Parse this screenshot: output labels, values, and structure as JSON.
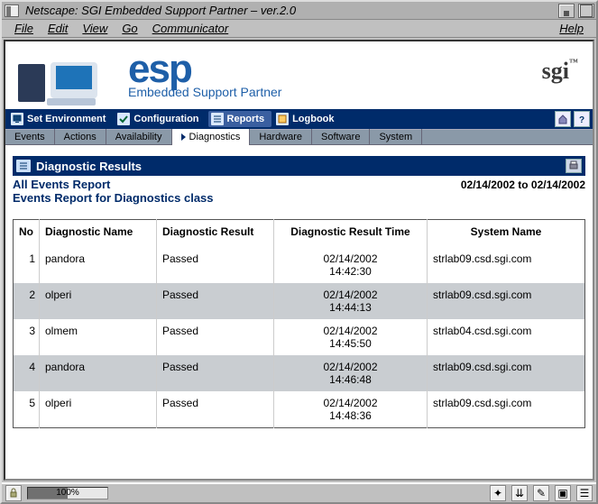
{
  "window": {
    "title": "Netscape: SGI Embedded Support Partner – ver.2.0"
  },
  "menubar": {
    "file": "File",
    "edit": "Edit",
    "view": "View",
    "go": "Go",
    "communicator": "Communicator",
    "help": "Help"
  },
  "banner": {
    "logo_big": "esp",
    "logo_sub": "Embedded Support Partner",
    "brand": "sgi"
  },
  "nav_primary": {
    "set_env": "Set Environment",
    "configuration": "Configuration",
    "reports": "Reports",
    "logbook": "Logbook"
  },
  "nav_secondary": {
    "events": "Events",
    "actions": "Actions",
    "availability": "Availability",
    "diagnostics": "Diagnostics",
    "hardware": "Hardware",
    "software": "Software",
    "system": "System"
  },
  "panel": {
    "title": "Diagnostic Results",
    "sub1": "All Events Report",
    "sub2": "Events Report for Diagnostics class",
    "daterange": "02/14/2002 to 02/14/2002"
  },
  "table": {
    "headers": {
      "no": "No",
      "name": "Diagnostic Name",
      "result": "Diagnostic Result",
      "time": "Diagnostic Result Time",
      "system": "System Name"
    },
    "rows": [
      {
        "no": "1",
        "name": "pandora",
        "result": "Passed",
        "time_date": "02/14/2002",
        "time_clock": "14:42:30",
        "system": "strlab09.csd.sgi.com"
      },
      {
        "no": "2",
        "name": "olperi",
        "result": "Passed",
        "time_date": "02/14/2002",
        "time_clock": "14:44:13",
        "system": "strlab09.csd.sgi.com"
      },
      {
        "no": "3",
        "name": "olmem",
        "result": "Passed",
        "time_date": "02/14/2002",
        "time_clock": "14:45:50",
        "system": "strlab04.csd.sgi.com"
      },
      {
        "no": "4",
        "name": "pandora",
        "result": "Passed",
        "time_date": "02/14/2002",
        "time_clock": "14:46:48",
        "system": "strlab09.csd.sgi.com"
      },
      {
        "no": "5",
        "name": "olperi",
        "result": "Passed",
        "time_date": "02/14/2002",
        "time_clock": "14:48:36",
        "system": "strlab09.csd.sgi.com"
      }
    ]
  },
  "status": {
    "percent": "100%"
  }
}
